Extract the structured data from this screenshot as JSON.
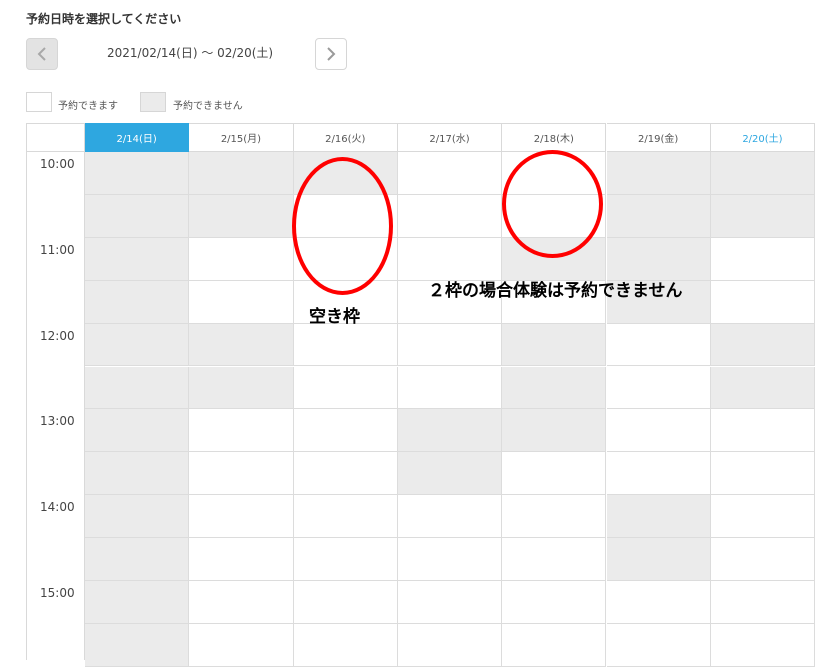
{
  "heading": "予約日時を選択してください",
  "date_range": "2021/02/14(日) ～ 02/20(土)",
  "legend": {
    "available": "予約できます",
    "unavailable": "予約できません"
  },
  "columns": [
    {
      "label": "2/14(日)",
      "style": "today"
    },
    {
      "label": "2/15(月)",
      "style": "normal"
    },
    {
      "label": "2/16(火)",
      "style": "normal"
    },
    {
      "label": "2/17(水)",
      "style": "normal"
    },
    {
      "label": "2/18(木)",
      "style": "normal"
    },
    {
      "label": "2/19(金)",
      "style": "normal"
    },
    {
      "label": "2/20(土)",
      "style": "saturday"
    }
  ],
  "times": [
    "10:00",
    "11:00",
    "12:00",
    "13:00",
    "14:00",
    "15:00"
  ],
  "slots": [
    [
      "closed",
      "closed",
      "closed",
      "closed",
      "closed",
      "closed",
      "closed",
      "closed",
      "closed",
      "closed",
      "closed",
      "closed"
    ],
    [
      "closed",
      "closed",
      "open",
      "open",
      "closed",
      "closed",
      "open",
      "open",
      "open",
      "open",
      "open",
      "open"
    ],
    [
      "closed",
      "open",
      "open",
      "open",
      "open",
      "open",
      "open",
      "open",
      "open",
      "open",
      "open",
      "open"
    ],
    [
      "open",
      "open",
      "open",
      "open",
      "open",
      "open",
      "closed",
      "closed",
      "open",
      "open",
      "open",
      "open"
    ],
    [
      "open",
      "open",
      "closed",
      "open",
      "closed",
      "closed",
      "closed",
      "open",
      "open",
      "open",
      "open",
      "open"
    ],
    [
      "closed",
      "closed",
      "closed",
      "closed",
      "open",
      "open",
      "open",
      "open",
      "closed",
      "closed",
      "open",
      "open"
    ],
    [
      "closed",
      "closed",
      "open",
      "open",
      "closed",
      "closed",
      "open",
      "open",
      "open",
      "open",
      "open",
      "open"
    ]
  ],
  "annotations": {
    "free_slot": "空き枠",
    "two_slot_note": "２枠の場合体験は予約できません"
  },
  "colors": {
    "accent": "#2ea7e0",
    "unavailable": "#ebebeb",
    "highlight": "#ff0000"
  }
}
